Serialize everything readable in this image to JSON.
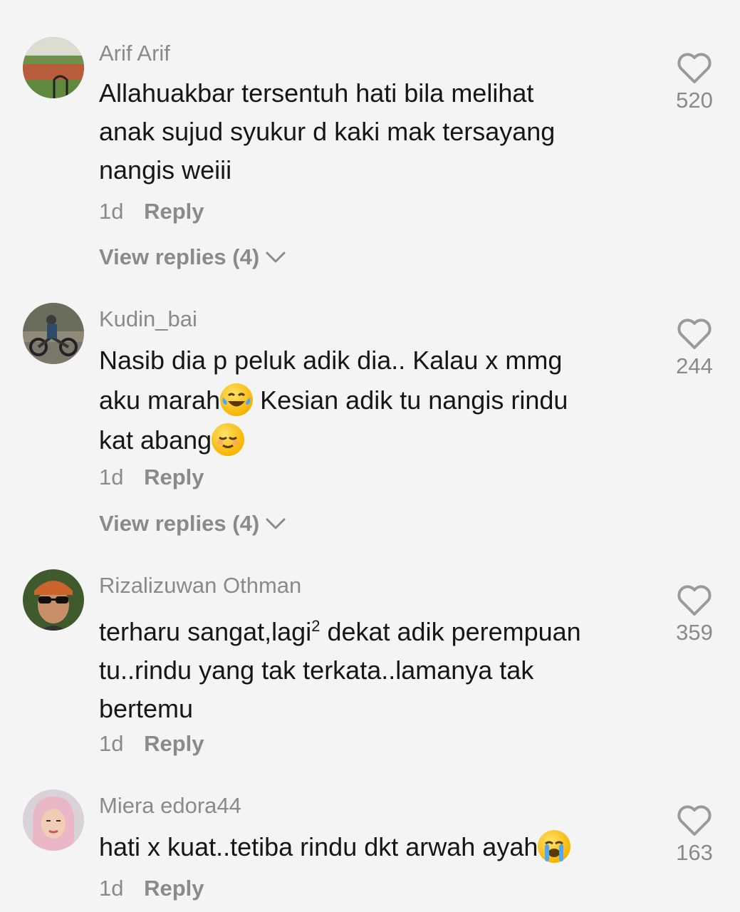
{
  "comments": [
    {
      "username": "Arif Arif",
      "lines": [
        "Allahuakbar tersentuh hati bila melihat",
        "anak sujud syukur d kaki mak tersayang",
        "nangis weiii"
      ],
      "time": "1d",
      "reply_label": "Reply",
      "view_replies": "View replies (4)",
      "likes": "520",
      "avatar_icon": "stadium-photo-avatar"
    },
    {
      "username": "Kudin_bai",
      "line1": "Nasib dia p peluk adik dia.. Kalau x mmg",
      "line2a": "aku marah",
      "line2b": " Kesian adik tu nangis rindu",
      "line3": "kat abang",
      "emoji_1": "joy-tears-emoji",
      "emoji_2": "relieved-face-emoji",
      "time": "1d",
      "reply_label": "Reply",
      "view_replies": "View replies (4)",
      "likes": "244",
      "avatar_icon": "motorcycle-photo-avatar"
    },
    {
      "username": "Rizalizuwan Othman",
      "line1a": "terharu sangat,lagi",
      "line1sup": "2",
      "line1b": " dekat adik perempuan",
      "line2": "tu..rindu yang tak terkata..lamanya tak",
      "line3": "bertemu",
      "time": "1d",
      "reply_label": "Reply",
      "likes": "359",
      "avatar_icon": "man-sunglasses-avatar"
    },
    {
      "username": "Miera edora44",
      "line1": "hati x kuat..tetiba rindu dkt arwah ayah",
      "emoji_1": "crying-face-emoji",
      "time": "1d",
      "reply_label": "Reply",
      "likes": "163",
      "avatar_icon": "woman-hijab-avatar"
    }
  ],
  "colors": {
    "background": "#f4f4f4",
    "text": "#161616",
    "muted": "#8a8a8a",
    "icon": "#9a9a9a"
  }
}
